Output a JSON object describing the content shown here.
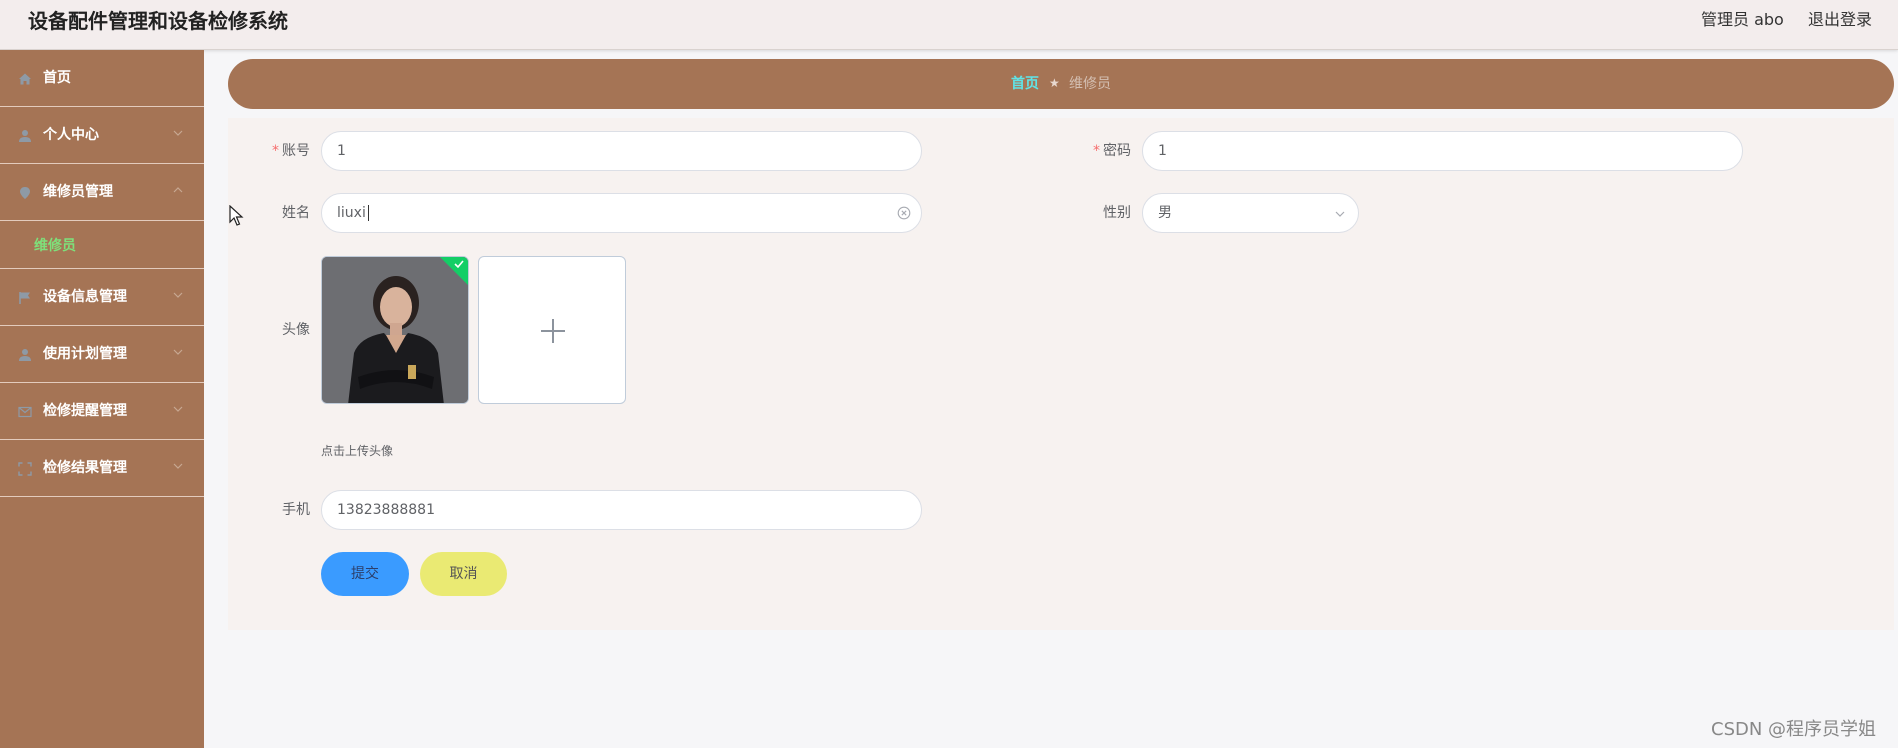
{
  "header": {
    "title": "设备配件管理和设备检修系统",
    "admin_label": "管理员 abo",
    "logout_label": "退出登录"
  },
  "sidebar": {
    "items": [
      {
        "label": "首页",
        "icon": "home-icon"
      },
      {
        "label": "个人中心",
        "icon": "user-icon"
      },
      {
        "label": "维修员管理",
        "icon": "pin-icon"
      },
      {
        "label": "设备信息管理",
        "icon": "flag-icon"
      },
      {
        "label": "使用计划管理",
        "icon": "user-icon"
      },
      {
        "label": "检修提醒管理",
        "icon": "message-icon"
      },
      {
        "label": "检修结果管理",
        "icon": "fullscreen-icon"
      }
    ],
    "active_submenu": {
      "label": "维修员"
    }
  },
  "breadcrumb": {
    "home": "首页",
    "separator": "★",
    "current": "维修员"
  },
  "form": {
    "account": {
      "label": "账号",
      "value": "1"
    },
    "password": {
      "label": "密码",
      "value": "1"
    },
    "name": {
      "label": "姓名",
      "value": "liuxi"
    },
    "gender": {
      "label": "性别",
      "value": "男"
    },
    "avatar": {
      "label": "头像",
      "hint": "点击上传头像"
    },
    "phone": {
      "label": "手机",
      "value": "13823888881"
    },
    "submit_label": "提交",
    "cancel_label": "取消"
  },
  "watermark": "CSDN @程序员学姐",
  "colors": {
    "sidebar_bg": "#a57455",
    "accent_cyan": "#60e3e6",
    "submenu_active": "#7ee07a",
    "submit_btn": "#3a9bff",
    "cancel_btn": "#eaea73",
    "success_green": "#13ce66"
  }
}
